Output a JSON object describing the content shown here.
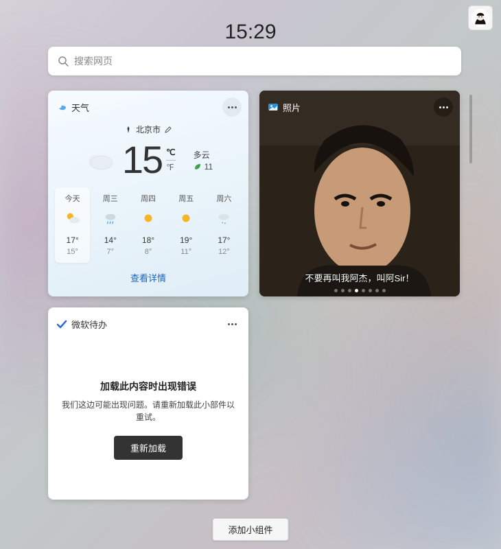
{
  "clock": "15:29",
  "search": {
    "placeholder": "搜索网页"
  },
  "weather": {
    "title": "天气",
    "location": "北京市",
    "temp": "15",
    "unit_active": "℃",
    "unit_inactive": "℉",
    "condition": "多云",
    "aqi_icon_label": "空气质量",
    "aqi_value": "11",
    "forecast": [
      {
        "label": "今天",
        "icon": "partly",
        "hi": "17°",
        "lo": "15°"
      },
      {
        "label": "周三",
        "icon": "shower",
        "hi": "14°",
        "lo": "7°"
      },
      {
        "label": "周四",
        "icon": "sunny",
        "hi": "18°",
        "lo": "8°"
      },
      {
        "label": "周五",
        "icon": "sunny",
        "hi": "19°",
        "lo": "11°"
      },
      {
        "label": "周六",
        "icon": "drizzle",
        "hi": "17°",
        "lo": "12°"
      }
    ],
    "details_link": "查看详情"
  },
  "photos": {
    "title": "照片",
    "caption": "不要再叫我阿杰，叫阿Sir！",
    "dot_count": 8,
    "active_dot": 3
  },
  "todo": {
    "title": "微软待办",
    "error_title": "加载此内容时出现错误",
    "error_message": "我们这边可能出现问题。请重新加载此小部件以重试。",
    "reload_label": "重新加载"
  },
  "footer": {
    "add_widget": "添加小组件"
  },
  "colors": {
    "link_blue": "#1a63c2",
    "accent_green": "#3aa34a",
    "sun_yellow": "#f5b527",
    "cloud_gray": "#c6d3dc"
  }
}
